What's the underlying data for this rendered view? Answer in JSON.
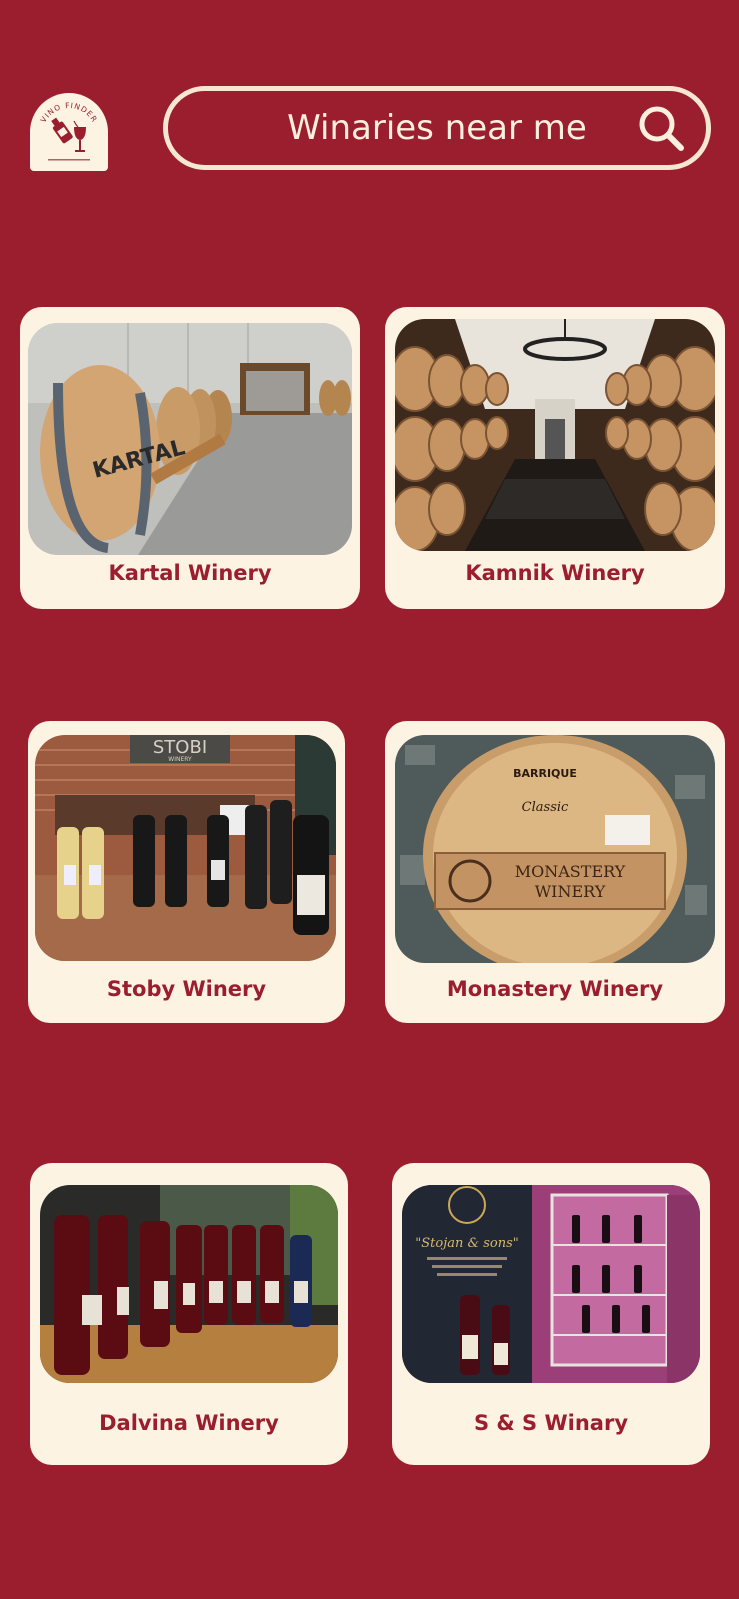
{
  "app": {
    "logo_icon": "wine-finder-logo",
    "logo_text": "VINO FINDER"
  },
  "search": {
    "text": "Winaries near me",
    "icon": "search-icon"
  },
  "colors": {
    "background": "#9b1e2e",
    "card": "#fcf3e3",
    "accent_text": "#9b1e2e"
  },
  "wineries": [
    {
      "name": "Kartal Winery"
    },
    {
      "name": "Kamnik Winery"
    },
    {
      "name": "Stoby Winery"
    },
    {
      "name": "Monastery Winery"
    },
    {
      "name": "Dalvina Winery"
    },
    {
      "name": "S & S Winary"
    }
  ],
  "photo_labels": {
    "kartal_barrel": "KARTAL",
    "stobi_sign": "STOBI",
    "stobi_sign_sub": "WINERY",
    "monastery_brand": "BARRIQUE",
    "monastery_line1": "MONASTERY",
    "monastery_line2": "WINERY",
    "monastery_classic": "Classic",
    "ss_poster": "\"Stojan & sons\""
  }
}
